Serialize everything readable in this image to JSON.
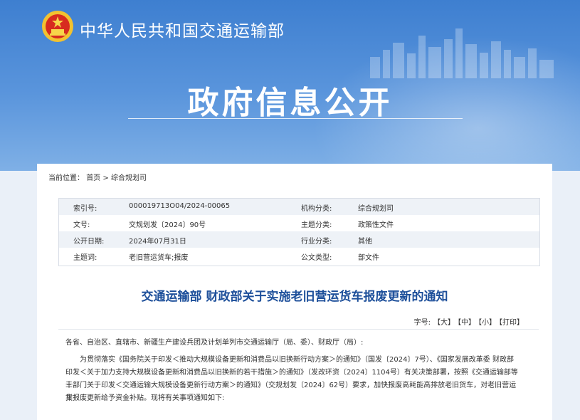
{
  "header": {
    "site_name": "中华人民共和国交通运输部",
    "hero_title": "政府信息公开"
  },
  "breadcrumb": {
    "label": "当前位置：",
    "home": "首页",
    "sep": ">",
    "current": "综合规划司"
  },
  "meta": {
    "rows": [
      {
        "l1": "索引号:",
        "v1": "000019713O04/2024-00065",
        "l2": "机构分类:",
        "v2": "综合规划司"
      },
      {
        "l1": "文号:",
        "v1": "交规划发〔2024〕90号",
        "l2": "主题分类:",
        "v2": "政策性文件"
      },
      {
        "l1": "公开日期:",
        "v1": "2024年07月31日",
        "l2": "行业分类:",
        "v2": "其他"
      },
      {
        "l1": "主题词:",
        "v1": "老旧营运货车;报废",
        "l2": "公文类型:",
        "v2": "部文件"
      }
    ]
  },
  "article": {
    "title": "交通运输部 财政部关于实施老旧营运货车报废更新的通知",
    "font_size_label": "字号:",
    "font_large": "【大】",
    "font_medium": "【中】",
    "font_small": "【小】",
    "print": "【打印】",
    "salutation": "各省、自治区、直辖市、新疆生产建设兵团及计划单列市交通运输厅（局、委）、财政厅（局）:",
    "para_lines": [
      "为贯彻落实《国务院关于印发＜推动大规模设备更新和消费品以旧换新行动方案＞的通知》（国发〔2024〕7号）、《国家发展改革委 财政部",
      "印发＜关于加力支持大规模设备更新和消费品以旧换新的若干措施＞的通知》（发改环资〔2024〕1104号）有关决策部署，按照《交通运输部等十",
      "三部门关于印发＜交通运输大规模设备更新行动方案＞的通知》（交规划发〔2024〕62号）要求，加快报废高耗能高排放老旧货车，对老旧营运货",
      "车报废更新给予资金补贴。现将有关事项通知如下:"
    ]
  },
  "colors": {
    "banner": "#4a88d6",
    "title": "#1d4f9a"
  }
}
